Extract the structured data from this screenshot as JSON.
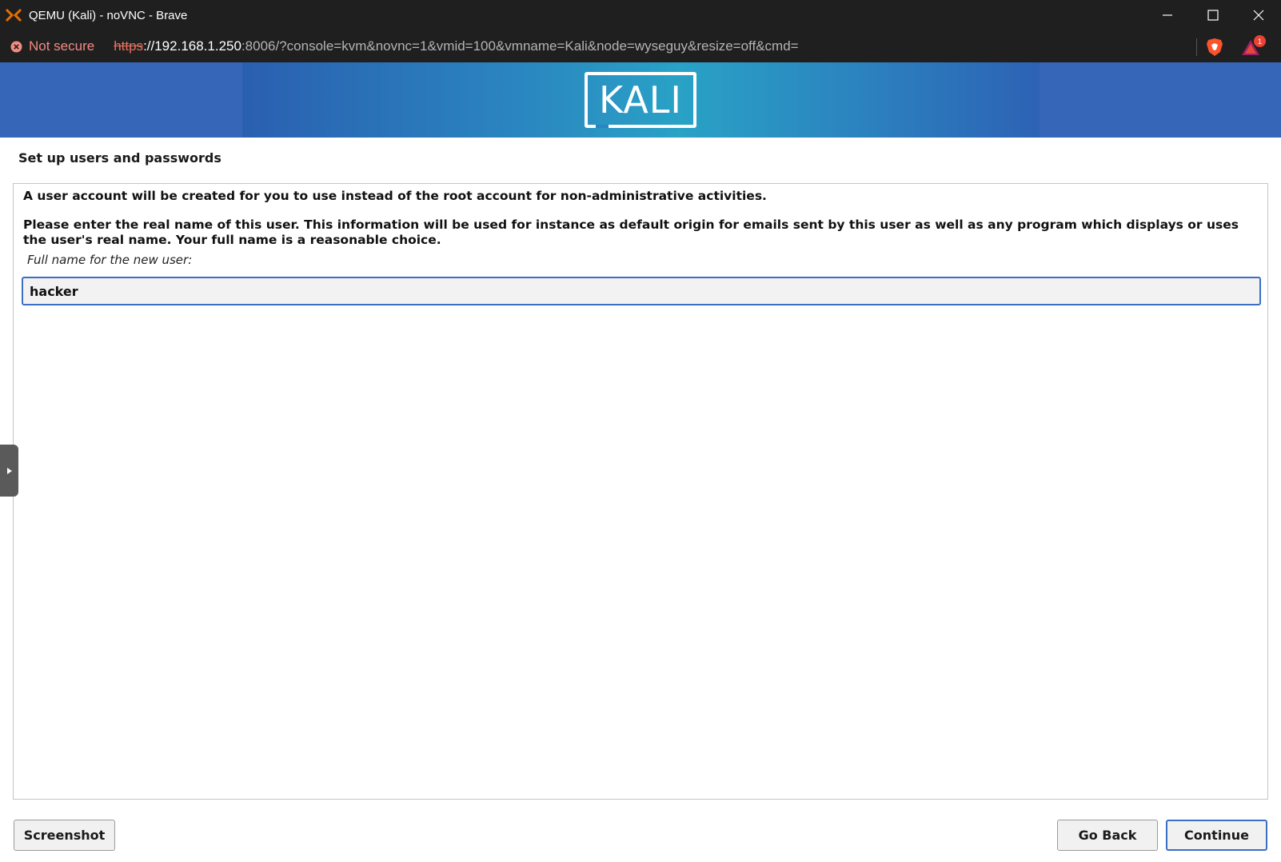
{
  "window": {
    "title": "QEMU (Kali) - noVNC - Brave"
  },
  "addressbar": {
    "security_text": "Not secure",
    "url_scheme": "https",
    "url_host": "://192.168.1.250",
    "url_rest": ":8006/?console=kvm&novnc=1&vmid=100&vmname=Kali&node=wyseguy&resize=off&cmd=",
    "rewards_badge": "1"
  },
  "installer": {
    "logo_text": "KALI",
    "step_title": "Set up users and passwords",
    "paragraph1": "A user account will be created for you to use instead of the root account for non-administrative activities.",
    "paragraph2": "Please enter the real name of this user. This information will be used for instance as default origin for emails sent by this user as well as any program which displays or uses the user's real name. Your full name is a reasonable choice.",
    "field_label": "Full name for the new user:",
    "field_value": "hacker",
    "buttons": {
      "screenshot": "Screenshot",
      "go_back": "Go Back",
      "continue": "Continue"
    }
  },
  "colors": {
    "accent": "#3b6fc4",
    "banner": "#3566b8",
    "not_secure": "#f28b82"
  }
}
